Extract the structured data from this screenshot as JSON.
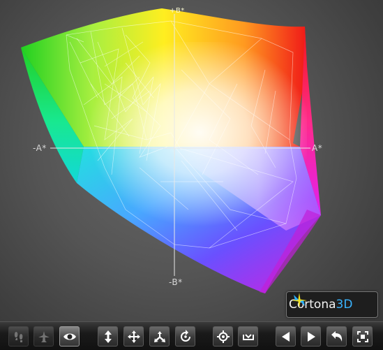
{
  "viewer": {
    "axis_labels": {
      "a_negative": "-A*",
      "a_positive": "A*",
      "b_negative": "-B*",
      "b_positive": "+B*"
    }
  },
  "logo": {
    "brand_main": "Cortona",
    "brand_accent": "3D",
    "icon": "cortona-star-icon"
  },
  "toolbar": {
    "buttons": [
      {
        "name": "walk-button",
        "icon": "footprints-icon",
        "state": "disabled"
      },
      {
        "name": "fly-button",
        "icon": "plane-icon",
        "state": "disabled"
      },
      {
        "name": "study-button",
        "icon": "eye-icon",
        "state": "active"
      },
      {
        "name": "slide-button",
        "icon": "vertical-arrows-icon",
        "state": "normal"
      },
      {
        "name": "pan-button",
        "icon": "four-way-arrows-icon",
        "state": "normal"
      },
      {
        "name": "tilt-button",
        "icon": "tilt-arrows-icon",
        "state": "normal"
      },
      {
        "name": "rotate-button",
        "icon": "rotate-icon",
        "state": "normal"
      },
      {
        "name": "goto-button",
        "icon": "crosshair-icon",
        "state": "normal"
      },
      {
        "name": "align-button",
        "icon": "align-bracket-icon",
        "state": "normal"
      },
      {
        "name": "previous-viewpoint-button",
        "icon": "triangle-left-icon",
        "state": "normal"
      },
      {
        "name": "next-viewpoint-button",
        "icon": "triangle-right-icon",
        "state": "normal"
      },
      {
        "name": "restore-button",
        "icon": "undo-arrow-icon",
        "state": "normal"
      },
      {
        "name": "fit-button",
        "icon": "fit-frame-icon",
        "state": "normal"
      }
    ]
  },
  "colors": {
    "background": "#4e4e4e",
    "accent": "#3ab4ff",
    "gamut_white": "#ffffff",
    "gamut_red": "#e81010",
    "gamut_green": "#20d020",
    "gamut_blue": "#2a60ff",
    "gamut_magenta": "#e020e0",
    "gamut_yellow": "#f0f020",
    "gamut_cyan": "#10e0e0"
  }
}
